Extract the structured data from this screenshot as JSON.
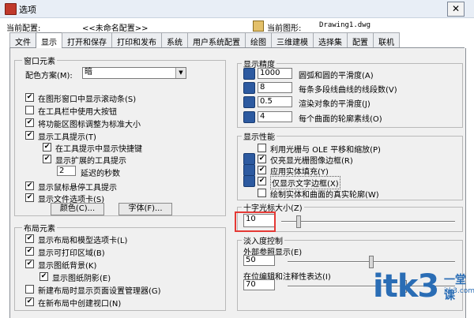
{
  "window": {
    "title": "选项",
    "close": "✕"
  },
  "info": {
    "profile_label": "当前配置:",
    "profile_value": "<<未命名配置>>",
    "drawing_label": "当前图形:",
    "drawing_value": "Drawing1.dwg"
  },
  "tabs": [
    "文件",
    "显示",
    "打开和保存",
    "打印和发布",
    "系统",
    "用户系统配置",
    "绘图",
    "三维建模",
    "选择集",
    "配置",
    "联机"
  ],
  "window_elements": {
    "legend": "窗口元素",
    "color_scheme_label": "配色方案(M):",
    "color_scheme_value": "暗",
    "items": [
      {
        "label": "在图形窗口中显示滚动条(S)",
        "checked": true
      },
      {
        "label": "在工具栏中使用大按钮",
        "checked": false
      },
      {
        "label": "将功能区图标调整为标准大小",
        "checked": true
      },
      {
        "label": "显示工具提示(T)",
        "checked": true
      },
      {
        "label": "在工具提示中显示快捷键",
        "checked": true
      },
      {
        "label": "显示扩展的工具提示",
        "checked": true
      },
      {
        "label": "显示鼠标悬停工具提示",
        "checked": true
      },
      {
        "label": "显示文件选项卡(S)",
        "checked": true
      }
    ],
    "delay_value": "2",
    "delay_label": "延迟的秒数",
    "colors_button": "颜色(C)...",
    "fonts_button": "字体(F)..."
  },
  "layout_elements": {
    "legend": "布局元素",
    "items": [
      {
        "label": "显示布局和模型选项卡(L)",
        "checked": true
      },
      {
        "label": "显示可打印区域(B)",
        "checked": true
      },
      {
        "label": "显示图纸背景(K)",
        "checked": true
      },
      {
        "label": "显示图纸阴影(E)",
        "checked": true
      },
      {
        "label": "新建布局时显示页面设置管理器(G)",
        "checked": false
      },
      {
        "label": "在新布局中创建视口(N)",
        "checked": true
      }
    ]
  },
  "display_resolution": {
    "legend": "显示精度",
    "items": [
      {
        "value": "1000",
        "label": "圆弧和圆的平滑度(A)"
      },
      {
        "value": "8",
        "label": "每条多段线曲线的线段数(V)"
      },
      {
        "value": "0.5",
        "label": "渲染对象的平滑度(J)"
      },
      {
        "value": "4",
        "label": "每个曲面的轮廓素线(O)"
      }
    ]
  },
  "display_performance": {
    "legend": "显示性能",
    "items": [
      {
        "label": "利用光栅与 OLE 平移和缩放(P)",
        "checked": false
      },
      {
        "label": "仅亮显光栅图像边框(R)",
        "checked": true
      },
      {
        "label": "应用实体填充(Y)",
        "checked": true
      },
      {
        "label": "仅显示文字边框(X)",
        "checked": true
      },
      {
        "label": "绘制实体和曲面的真实轮廓(W)",
        "checked": false
      }
    ]
  },
  "crosshair": {
    "legend": "十字光标大小(Z)",
    "value": "10",
    "slider_fraction": 0.1
  },
  "fade": {
    "legend": "淡入度控制",
    "xref_label": "外部参照显示(E)",
    "xref_value": "50",
    "xref_fraction": 0.5,
    "inplace_label": "在位编辑和注释性表达(I)",
    "inplace_value": "70",
    "inplace_fraction": 0.7
  },
  "watermark": {
    "text": "itk3",
    "cn": "一堂课",
    "url": "itk3.com"
  }
}
